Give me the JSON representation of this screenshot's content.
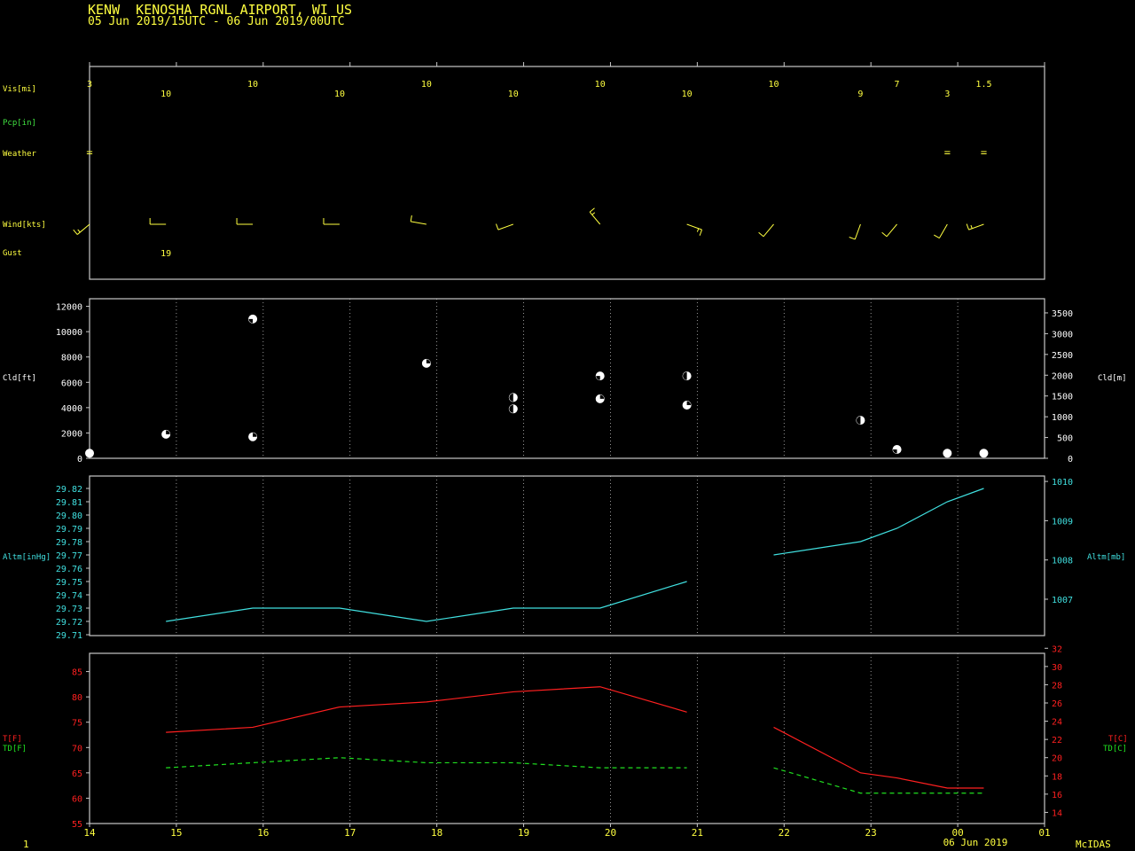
{
  "header": {
    "title": "KENW  KENOSHA RGNL AIRPORT, WI US",
    "subtitle": "05 Jun 2019/15UTC - 06 Jun 2019/00UTC"
  },
  "footer": {
    "page": "1",
    "brand": "McIDAS",
    "date_label": "06 Jun 2019"
  },
  "colors": {
    "frame": "#c8c8c8",
    "grid": "#bbbbbb",
    "label": "#ffff40",
    "pcp": "#40e040",
    "altim": "#40e0e0",
    "temp": "#ff2020",
    "dewpoint": "#20e020",
    "cloud": "#ffffff",
    "wind": "#ffff40"
  },
  "chart_data": [
    {
      "type": "table",
      "title": "Surface observations",
      "row_labels": {
        "vis": "Vis[mi]",
        "pcp": "Pcp[in]",
        "weather": "Weather",
        "wind": "Wind[kts]",
        "gust": "Gust"
      },
      "x_ticks": [
        "14",
        "15",
        "16",
        "17",
        "18",
        "19",
        "20",
        "21",
        "22",
        "23",
        "00",
        "01"
      ],
      "visibility": [
        {
          "t": 14.0,
          "value": "3"
        },
        {
          "t": 14.88,
          "value": "10"
        },
        {
          "t": 15.88,
          "value": "10"
        },
        {
          "t": 16.88,
          "value": "10"
        },
        {
          "t": 17.88,
          "value": "10"
        },
        {
          "t": 18.88,
          "value": "10"
        },
        {
          "t": 19.88,
          "value": "10"
        },
        {
          "t": 20.88,
          "value": "10"
        },
        {
          "t": 21.88,
          "value": "10"
        },
        {
          "t": 22.88,
          "value": "9"
        },
        {
          "t": 23.3,
          "value": "7"
        },
        {
          "t": 23.88,
          "value": "3"
        },
        {
          "t": 24.3,
          "value": "1.5"
        }
      ],
      "weather": [
        {
          "t": 14.0,
          "symbol": "="
        },
        {
          "t": 23.88,
          "symbol": "="
        },
        {
          "t": 24.3,
          "symbol": "="
        }
      ],
      "wind": [
        {
          "t": 14.0,
          "dir": 230,
          "speed": 5
        },
        {
          "t": 14.88,
          "dir": 270,
          "speed": 10
        },
        {
          "t": 15.88,
          "dir": 270,
          "speed": 10
        },
        {
          "t": 16.88,
          "dir": 270,
          "speed": 10
        },
        {
          "t": 17.88,
          "dir": 280,
          "speed": 10
        },
        {
          "t": 18.88,
          "dir": 250,
          "speed": 10
        },
        {
          "t": 19.88,
          "dir": 320,
          "speed": 5
        },
        {
          "t": 20.88,
          "dir": 110,
          "speed": 5
        },
        {
          "t": 21.88,
          "dir": 220,
          "speed": 10
        },
        {
          "t": 22.88,
          "dir": 200,
          "speed": 10
        },
        {
          "t": 23.3,
          "dir": 220,
          "speed": 10
        },
        {
          "t": 23.88,
          "dir": 210,
          "speed": 10
        },
        {
          "t": 24.3,
          "dir": 250,
          "speed": 5
        }
      ],
      "gust": [
        {
          "t": 14.88,
          "value": "19"
        }
      ]
    },
    {
      "type": "scatter",
      "title": "Cloud heights",
      "ylabel": "Cld[ft]",
      "ylabel_right": "Cld[m]",
      "ylim": [
        0,
        12600
      ],
      "yticks": [
        0,
        2000,
        4000,
        6000,
        8000,
        10000,
        12000
      ],
      "yticks_right": [
        0,
        500,
        1000,
        1500,
        2000,
        2500,
        3000,
        3500
      ],
      "points": [
        {
          "t": 14.0,
          "ft": 400,
          "cover": 4
        },
        {
          "t": 14.88,
          "ft": 1900,
          "cover": 1
        },
        {
          "t": 15.88,
          "ft": 1700,
          "cover": 1
        },
        {
          "t": 15.88,
          "ft": 11000,
          "cover": 3
        },
        {
          "t": 17.88,
          "ft": 7500,
          "cover": 1
        },
        {
          "t": 18.88,
          "ft": 3900,
          "cover": 2
        },
        {
          "t": 18.88,
          "ft": 4800,
          "cover": 2
        },
        {
          "t": 19.88,
          "ft": 4700,
          "cover": 1
        },
        {
          "t": 19.88,
          "ft": 6500,
          "cover": 3
        },
        {
          "t": 20.88,
          "ft": 4200,
          "cover": 1
        },
        {
          "t": 20.88,
          "ft": 6500,
          "cover": 2
        },
        {
          "t": 22.88,
          "ft": 3000,
          "cover": 2
        },
        {
          "t": 23.3,
          "ft": 700,
          "cover": 3
        },
        {
          "t": 23.88,
          "ft": 400,
          "cover": 4
        },
        {
          "t": 24.3,
          "ft": 400,
          "cover": 4
        }
      ]
    },
    {
      "type": "line",
      "title": "Altimeter",
      "ylabel": "Altm[inHg]",
      "ylabel_right": "Altm[mb]",
      "ylim": [
        29.71,
        29.82
      ],
      "yticks": [
        "29.71",
        "29.72",
        "29.73",
        "29.74",
        "29.75",
        "29.76",
        "29.77",
        "29.78",
        "29.79",
        "29.80",
        "29.81",
        "29.82"
      ],
      "yticks_right": [
        1007,
        1008,
        1009,
        1010
      ],
      "segments": [
        [
          {
            "t": 14.88,
            "v": 29.72
          },
          {
            "t": 15.88,
            "v": 29.73
          },
          {
            "t": 16.88,
            "v": 29.73
          },
          {
            "t": 17.88,
            "v": 29.72
          },
          {
            "t": 18.88,
            "v": 29.73
          },
          {
            "t": 19.88,
            "v": 29.73
          },
          {
            "t": 20.88,
            "v": 29.75
          }
        ],
        [
          {
            "t": 21.88,
            "v": 29.77
          },
          {
            "t": 22.88,
            "v": 29.78
          },
          {
            "t": 23.3,
            "v": 29.79
          },
          {
            "t": 23.88,
            "v": 29.81
          },
          {
            "t": 24.3,
            "v": 29.82
          }
        ]
      ]
    },
    {
      "type": "line",
      "title": "Temperature and dewpoint",
      "ylabel": "T[F]",
      "ylabel2": "TD[F]",
      "ylabel_right": "T[C]",
      "ylabel_right2": "TD[C]",
      "xlabel": "06 Jun 2019",
      "ylim": [
        55,
        88.6
      ],
      "yticks": [
        55,
        60,
        65,
        70,
        75,
        80,
        85
      ],
      "yticks_right": [
        14,
        16,
        18,
        20,
        22,
        24,
        26,
        28,
        30,
        32
      ],
      "x_ticks": [
        "14",
        "15",
        "16",
        "17",
        "18",
        "19",
        "20",
        "21",
        "22",
        "23",
        "00",
        "01"
      ],
      "series": [
        {
          "name": "T[F]",
          "style": "solid",
          "segments": [
            [
              {
                "t": 14.88,
                "v": 73
              },
              {
                "t": 15.88,
                "v": 74
              },
              {
                "t": 16.88,
                "v": 78
              },
              {
                "t": 17.88,
                "v": 79
              },
              {
                "t": 18.88,
                "v": 81
              },
              {
                "t": 19.88,
                "v": 82
              },
              {
                "t": 20.88,
                "v": 77
              }
            ],
            [
              {
                "t": 21.88,
                "v": 74
              },
              {
                "t": 22.88,
                "v": 65
              },
              {
                "t": 23.3,
                "v": 64
              },
              {
                "t": 23.88,
                "v": 62
              },
              {
                "t": 24.3,
                "v": 62
              }
            ]
          ]
        },
        {
          "name": "TD[F]",
          "style": "dashed",
          "segments": [
            [
              {
                "t": 14.88,
                "v": 66
              },
              {
                "t": 15.88,
                "v": 67
              },
              {
                "t": 16.88,
                "v": 68
              },
              {
                "t": 17.88,
                "v": 67
              },
              {
                "t": 18.88,
                "v": 67
              },
              {
                "t": 19.88,
                "v": 66
              },
              {
                "t": 20.88,
                "v": 66
              }
            ],
            [
              {
                "t": 21.88,
                "v": 66
              },
              {
                "t": 22.88,
                "v": 61
              },
              {
                "t": 23.3,
                "v": 61
              },
              {
                "t": 23.88,
                "v": 61
              },
              {
                "t": 24.3,
                "v": 61
              }
            ]
          ]
        }
      ]
    }
  ]
}
